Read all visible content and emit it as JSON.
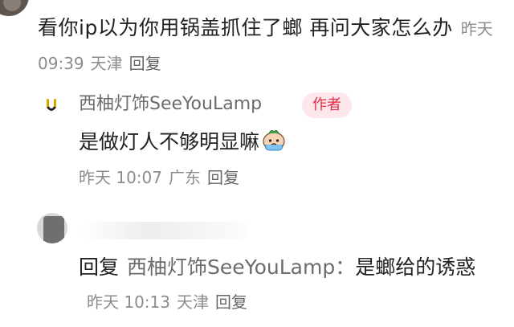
{
  "comment1": {
    "text": "看你ip以为你用锅盖抓住了螂 再问大家怎么办",
    "time": "昨天 09:39",
    "location": "天津",
    "reply_label": "回复"
  },
  "reply1": {
    "author": "西柚灯饰SeeYouLamp",
    "author_badge": "作者",
    "avatar_icon": "brand-logo-icon",
    "text": "是做灯人不够明显嘛",
    "emoji_icon": "crying-emoji-icon",
    "time": "昨天 10:07",
    "location": "广东",
    "reply_label": "回复"
  },
  "reply2": {
    "prefix": "回复",
    "reply_to": "西柚灯饰SeeYouLamp：",
    "text": "是螂给的诱惑",
    "time": "昨天 10:13",
    "location": "天津",
    "reply_label": "回复"
  },
  "colors": {
    "meta": "#8c8c8c",
    "username": "#6b6b6b",
    "badge_bg": "#fde7ea",
    "badge_text": "#e0304a"
  }
}
